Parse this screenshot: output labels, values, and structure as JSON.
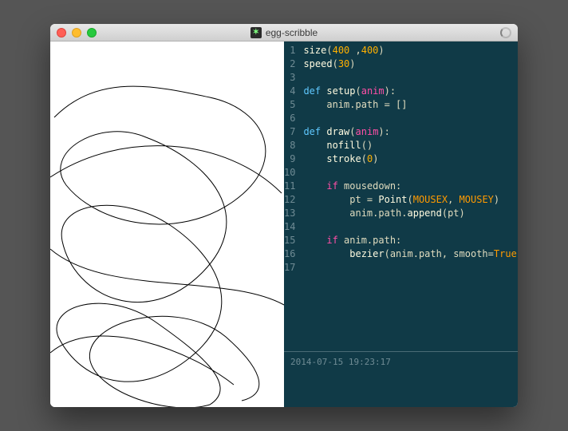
{
  "window": {
    "title": "egg-scribble"
  },
  "code": {
    "lines": [
      [
        {
          "t": "size",
          "c": "fn"
        },
        {
          "t": "(",
          "c": "txt"
        },
        {
          "t": "400",
          "c": "num"
        },
        {
          "t": " ,",
          "c": "txt"
        },
        {
          "t": "400",
          "c": "num"
        },
        {
          "t": ")",
          "c": "txt"
        }
      ],
      [
        {
          "t": "speed",
          "c": "fn"
        },
        {
          "t": "(",
          "c": "txt"
        },
        {
          "t": "30",
          "c": "num"
        },
        {
          "t": ")",
          "c": "txt"
        }
      ],
      [],
      [
        {
          "t": "def",
          "c": "kw"
        },
        {
          "t": " ",
          "c": ""
        },
        {
          "t": "setup",
          "c": "fn"
        },
        {
          "t": "(",
          "c": "txt"
        },
        {
          "t": "anim",
          "c": "arg"
        },
        {
          "t": "):",
          "c": "txt"
        }
      ],
      [
        {
          "t": "    anim.path = []",
          "c": "txt"
        }
      ],
      [],
      [
        {
          "t": "def",
          "c": "kw"
        },
        {
          "t": " ",
          "c": ""
        },
        {
          "t": "draw",
          "c": "fn"
        },
        {
          "t": "(",
          "c": "txt"
        },
        {
          "t": "anim",
          "c": "arg"
        },
        {
          "t": "):",
          "c": "txt"
        }
      ],
      [
        {
          "t": "    ",
          "c": ""
        },
        {
          "t": "nofill",
          "c": "fn"
        },
        {
          "t": "()",
          "c": "txt"
        }
      ],
      [
        {
          "t": "    ",
          "c": ""
        },
        {
          "t": "stroke",
          "c": "fn"
        },
        {
          "t": "(",
          "c": "txt"
        },
        {
          "t": "0",
          "c": "num"
        },
        {
          "t": ")",
          "c": "txt"
        }
      ],
      [],
      [
        {
          "t": "    ",
          "c": ""
        },
        {
          "t": "if",
          "c": "ctrl"
        },
        {
          "t": " mousedown:",
          "c": "txt"
        }
      ],
      [
        {
          "t": "        pt = ",
          "c": "txt"
        },
        {
          "t": "Point",
          "c": "fn"
        },
        {
          "t": "(",
          "c": "txt"
        },
        {
          "t": "MOUSEX",
          "c": "const"
        },
        {
          "t": ", ",
          "c": "txt"
        },
        {
          "t": "MOUSEY",
          "c": "const"
        },
        {
          "t": ")",
          "c": "txt"
        }
      ],
      [
        {
          "t": "        anim.path.",
          "c": "txt"
        },
        {
          "t": "append",
          "c": "fn"
        },
        {
          "t": "(pt)",
          "c": "txt"
        }
      ],
      [],
      [
        {
          "t": "    ",
          "c": ""
        },
        {
          "t": "if",
          "c": "ctrl"
        },
        {
          "t": " anim.path:",
          "c": "txt"
        }
      ],
      [
        {
          "t": "        ",
          "c": ""
        },
        {
          "t": "bezier",
          "c": "fn"
        },
        {
          "t": "(anim.path, smooth=",
          "c": "txt"
        },
        {
          "t": "True",
          "c": "const"
        },
        {
          "t": ")",
          "c": "txt"
        }
      ],
      []
    ]
  },
  "status": {
    "timestamp": "2014-07-15 19:23:17"
  }
}
